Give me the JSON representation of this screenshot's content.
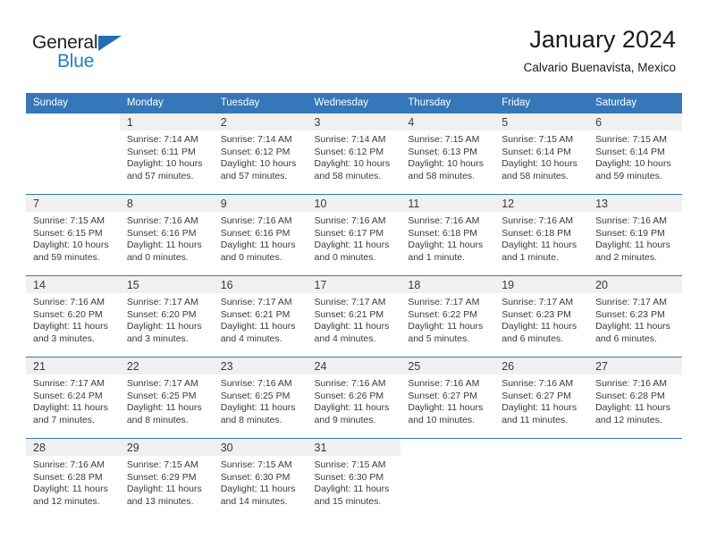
{
  "logo": {
    "word_top": "General",
    "word_bottom": "Blue",
    "triangle_color": "#1f6fb5",
    "blue_color": "#2180c4"
  },
  "header": {
    "title": "January 2024",
    "subtitle": "Calvario Buenavista, Mexico"
  },
  "theme": {
    "header_blue": "#3577b9",
    "daynum_band": "#f0f0f0",
    "text": "#3a3a3a"
  },
  "weekday_headers": [
    "Sunday",
    "Monday",
    "Tuesday",
    "Wednesday",
    "Thursday",
    "Friday",
    "Saturday"
  ],
  "weeks": [
    {
      "days": [
        {
          "num": "",
          "sunrise": "",
          "sunset": "",
          "daylight_1": "",
          "daylight_2": ""
        },
        {
          "num": "1",
          "sunrise": "Sunrise: 7:14 AM",
          "sunset": "Sunset: 6:11 PM",
          "daylight_1": "Daylight: 10 hours",
          "daylight_2": "and 57 minutes."
        },
        {
          "num": "2",
          "sunrise": "Sunrise: 7:14 AM",
          "sunset": "Sunset: 6:12 PM",
          "daylight_1": "Daylight: 10 hours",
          "daylight_2": "and 57 minutes."
        },
        {
          "num": "3",
          "sunrise": "Sunrise: 7:14 AM",
          "sunset": "Sunset: 6:12 PM",
          "daylight_1": "Daylight: 10 hours",
          "daylight_2": "and 58 minutes."
        },
        {
          "num": "4",
          "sunrise": "Sunrise: 7:15 AM",
          "sunset": "Sunset: 6:13 PM",
          "daylight_1": "Daylight: 10 hours",
          "daylight_2": "and 58 minutes."
        },
        {
          "num": "5",
          "sunrise": "Sunrise: 7:15 AM",
          "sunset": "Sunset: 6:14 PM",
          "daylight_1": "Daylight: 10 hours",
          "daylight_2": "and 58 minutes."
        },
        {
          "num": "6",
          "sunrise": "Sunrise: 7:15 AM",
          "sunset": "Sunset: 6:14 PM",
          "daylight_1": "Daylight: 10 hours",
          "daylight_2": "and 59 minutes."
        }
      ]
    },
    {
      "days": [
        {
          "num": "7",
          "sunrise": "Sunrise: 7:15 AM",
          "sunset": "Sunset: 6:15 PM",
          "daylight_1": "Daylight: 10 hours",
          "daylight_2": "and 59 minutes."
        },
        {
          "num": "8",
          "sunrise": "Sunrise: 7:16 AM",
          "sunset": "Sunset: 6:16 PM",
          "daylight_1": "Daylight: 11 hours",
          "daylight_2": "and 0 minutes."
        },
        {
          "num": "9",
          "sunrise": "Sunrise: 7:16 AM",
          "sunset": "Sunset: 6:16 PM",
          "daylight_1": "Daylight: 11 hours",
          "daylight_2": "and 0 minutes."
        },
        {
          "num": "10",
          "sunrise": "Sunrise: 7:16 AM",
          "sunset": "Sunset: 6:17 PM",
          "daylight_1": "Daylight: 11 hours",
          "daylight_2": "and 0 minutes."
        },
        {
          "num": "11",
          "sunrise": "Sunrise: 7:16 AM",
          "sunset": "Sunset: 6:18 PM",
          "daylight_1": "Daylight: 11 hours",
          "daylight_2": "and 1 minute."
        },
        {
          "num": "12",
          "sunrise": "Sunrise: 7:16 AM",
          "sunset": "Sunset: 6:18 PM",
          "daylight_1": "Daylight: 11 hours",
          "daylight_2": "and 1 minute."
        },
        {
          "num": "13",
          "sunrise": "Sunrise: 7:16 AM",
          "sunset": "Sunset: 6:19 PM",
          "daylight_1": "Daylight: 11 hours",
          "daylight_2": "and 2 minutes."
        }
      ]
    },
    {
      "days": [
        {
          "num": "14",
          "sunrise": "Sunrise: 7:16 AM",
          "sunset": "Sunset: 6:20 PM",
          "daylight_1": "Daylight: 11 hours",
          "daylight_2": "and 3 minutes."
        },
        {
          "num": "15",
          "sunrise": "Sunrise: 7:17 AM",
          "sunset": "Sunset: 6:20 PM",
          "daylight_1": "Daylight: 11 hours",
          "daylight_2": "and 3 minutes."
        },
        {
          "num": "16",
          "sunrise": "Sunrise: 7:17 AM",
          "sunset": "Sunset: 6:21 PM",
          "daylight_1": "Daylight: 11 hours",
          "daylight_2": "and 4 minutes."
        },
        {
          "num": "17",
          "sunrise": "Sunrise: 7:17 AM",
          "sunset": "Sunset: 6:21 PM",
          "daylight_1": "Daylight: 11 hours",
          "daylight_2": "and 4 minutes."
        },
        {
          "num": "18",
          "sunrise": "Sunrise: 7:17 AM",
          "sunset": "Sunset: 6:22 PM",
          "daylight_1": "Daylight: 11 hours",
          "daylight_2": "and 5 minutes."
        },
        {
          "num": "19",
          "sunrise": "Sunrise: 7:17 AM",
          "sunset": "Sunset: 6:23 PM",
          "daylight_1": "Daylight: 11 hours",
          "daylight_2": "and 6 minutes."
        },
        {
          "num": "20",
          "sunrise": "Sunrise: 7:17 AM",
          "sunset": "Sunset: 6:23 PM",
          "daylight_1": "Daylight: 11 hours",
          "daylight_2": "and 6 minutes."
        }
      ]
    },
    {
      "days": [
        {
          "num": "21",
          "sunrise": "Sunrise: 7:17 AM",
          "sunset": "Sunset: 6:24 PM",
          "daylight_1": "Daylight: 11 hours",
          "daylight_2": "and 7 minutes."
        },
        {
          "num": "22",
          "sunrise": "Sunrise: 7:17 AM",
          "sunset": "Sunset: 6:25 PM",
          "daylight_1": "Daylight: 11 hours",
          "daylight_2": "and 8 minutes."
        },
        {
          "num": "23",
          "sunrise": "Sunrise: 7:16 AM",
          "sunset": "Sunset: 6:25 PM",
          "daylight_1": "Daylight: 11 hours",
          "daylight_2": "and 8 minutes."
        },
        {
          "num": "24",
          "sunrise": "Sunrise: 7:16 AM",
          "sunset": "Sunset: 6:26 PM",
          "daylight_1": "Daylight: 11 hours",
          "daylight_2": "and 9 minutes."
        },
        {
          "num": "25",
          "sunrise": "Sunrise: 7:16 AM",
          "sunset": "Sunset: 6:27 PM",
          "daylight_1": "Daylight: 11 hours",
          "daylight_2": "and 10 minutes."
        },
        {
          "num": "26",
          "sunrise": "Sunrise: 7:16 AM",
          "sunset": "Sunset: 6:27 PM",
          "daylight_1": "Daylight: 11 hours",
          "daylight_2": "and 11 minutes."
        },
        {
          "num": "27",
          "sunrise": "Sunrise: 7:16 AM",
          "sunset": "Sunset: 6:28 PM",
          "daylight_1": "Daylight: 11 hours",
          "daylight_2": "and 12 minutes."
        }
      ]
    },
    {
      "days": [
        {
          "num": "28",
          "sunrise": "Sunrise: 7:16 AM",
          "sunset": "Sunset: 6:28 PM",
          "daylight_1": "Daylight: 11 hours",
          "daylight_2": "and 12 minutes."
        },
        {
          "num": "29",
          "sunrise": "Sunrise: 7:15 AM",
          "sunset": "Sunset: 6:29 PM",
          "daylight_1": "Daylight: 11 hours",
          "daylight_2": "and 13 minutes."
        },
        {
          "num": "30",
          "sunrise": "Sunrise: 7:15 AM",
          "sunset": "Sunset: 6:30 PM",
          "daylight_1": "Daylight: 11 hours",
          "daylight_2": "and 14 minutes."
        },
        {
          "num": "31",
          "sunrise": "Sunrise: 7:15 AM",
          "sunset": "Sunset: 6:30 PM",
          "daylight_1": "Daylight: 11 hours",
          "daylight_2": "and 15 minutes."
        },
        {
          "num": "",
          "sunrise": "",
          "sunset": "",
          "daylight_1": "",
          "daylight_2": ""
        },
        {
          "num": "",
          "sunrise": "",
          "sunset": "",
          "daylight_1": "",
          "daylight_2": ""
        },
        {
          "num": "",
          "sunrise": "",
          "sunset": "",
          "daylight_1": "",
          "daylight_2": ""
        }
      ]
    }
  ]
}
